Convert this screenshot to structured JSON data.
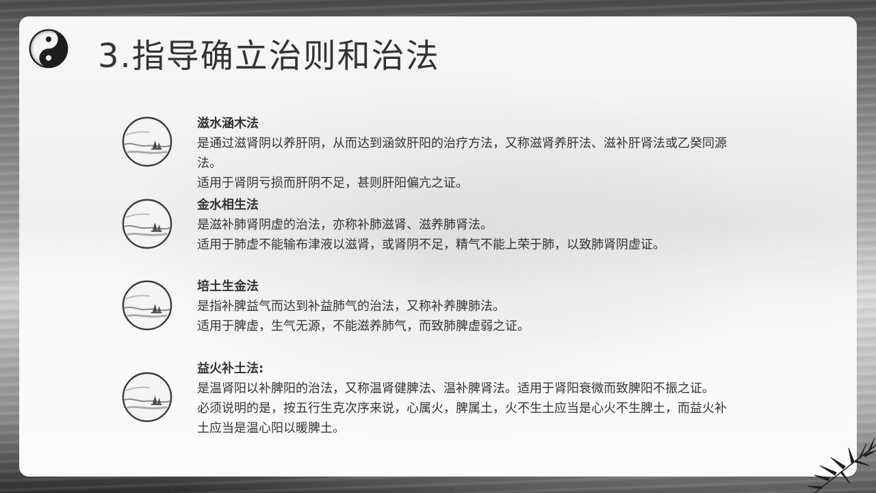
{
  "slide": {
    "title": "3.指导确立治则和治法"
  },
  "sections": [
    {
      "heading": "滋水涵木法",
      "lines": [
        "是通过滋肾阴以养肝阴，从而达到涵敛肝阳的治疗方法，又称滋肾养肝法、滋补肝肾法或乙癸同源",
        "法。",
        "适用于肾阴亏损而肝阴不足，甚则肝阳偏亢之证。"
      ]
    },
    {
      "heading": "金水相生法",
      "lines": [
        "是滋补肺肾阴虚的治法，亦称补肺滋肾、滋养肺肾法。",
        "适用于肺虚不能输布津液以滋肾，或肾阴不足，精气不能上荣于肺，以致肺肾阴虚证。"
      ]
    },
    {
      "heading": "培土生金法",
      "lines": [
        "是指补脾益气而达到补益肺气的治法，又称补养脾肺法。",
        "适用于脾虚，生气无源，不能滋养肺气，而致肺脾虚弱之证。"
      ]
    },
    {
      "heading": "益火补土法:",
      "lines": [
        "是温肾阳以补脾阳的治法，又称温肾健脾法、温补脾肾法。适用于肾阳衰微而致脾阳不振之证。",
        "必须说明的是，按五行生克次序来说，心属火，脾属土，火不生土应当是心火不生脾土，而益火补",
        "土应当是温心阳以暖脾土。"
      ]
    }
  ],
  "decor": {
    "logo_icon": "yin-yang-icon",
    "bullet_icon": "ink-landscape-medallion",
    "corner_icon": "bamboo-ink-icon",
    "ink_color": "#333333"
  }
}
